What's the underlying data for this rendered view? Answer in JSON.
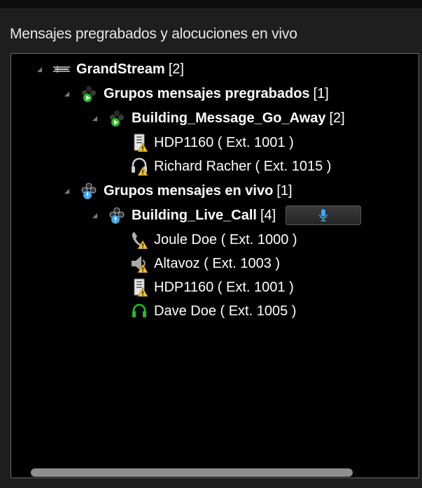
{
  "panel": {
    "title": "Mensajes pregrabados y alocuciones en vivo"
  },
  "tree": {
    "root": {
      "label": "GrandStream",
      "count": "[2]",
      "icon": "network-trunk-icon"
    },
    "groups": [
      {
        "label": "Grupos mensajes pregrabados",
        "count": "[1]",
        "icon": "prerecorded-group-icon",
        "children": [
          {
            "label": "Building_Message_Go_Away",
            "count": "[2]",
            "icon": "prerecorded-group-icon",
            "members": [
              {
                "label": "HDP1160 ( Ext. 1001 )",
                "icon": "intercom-warning-icon"
              },
              {
                "label": "Richard Racher ( Ext. 1015 )",
                "icon": "headset-warning-icon"
              }
            ]
          }
        ]
      },
      {
        "label": "Grupos mensajes en vivo",
        "count": "[1]",
        "icon": "live-group-icon",
        "children": [
          {
            "label": "Building_Live_Call",
            "count": "[4]",
            "icon": "live-group-icon",
            "button_icon": "microphone-icon",
            "members": [
              {
                "label": "Joule Doe ( Ext. 1000 )",
                "icon": "phone-warning-icon"
              },
              {
                "label": "Altavoz ( Ext. 1003 )",
                "icon": "speaker-warning-icon"
              },
              {
                "label": "HDP1160 ( Ext. 1001 )",
                "icon": "intercom-warning-icon"
              },
              {
                "label": "Dave Doe ( Ext. 1005 )",
                "icon": "headset-online-icon"
              }
            ]
          }
        ]
      }
    ]
  },
  "colors": {
    "background": "#000000",
    "accent_blue": "#3fa7f0",
    "online_green": "#1ec21e",
    "warning": "#f2c12e"
  }
}
